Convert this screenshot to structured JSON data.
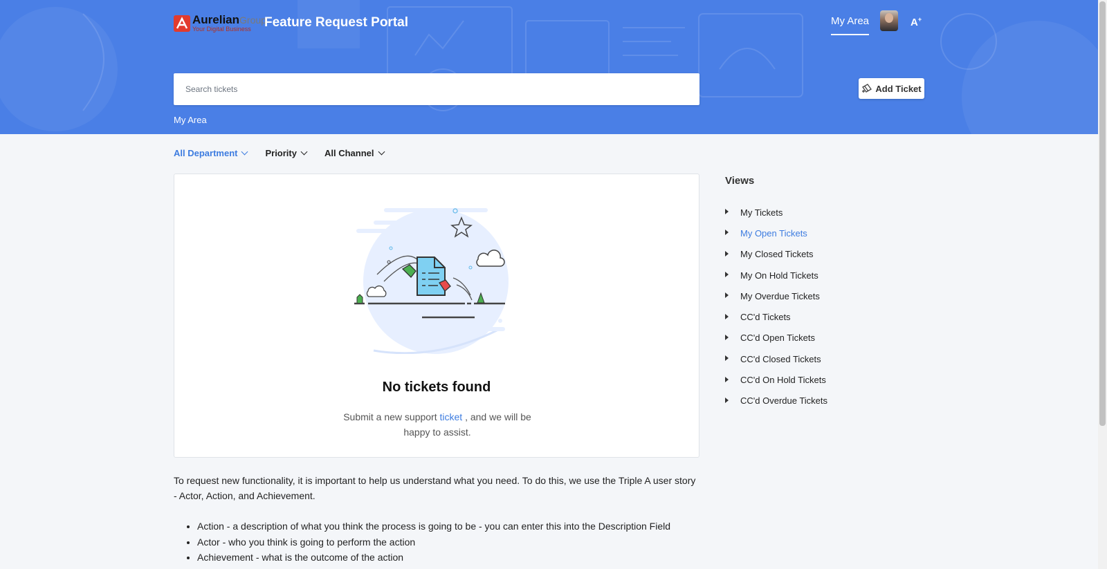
{
  "header": {
    "logo_name": "Aurelian",
    "logo_group": "Group",
    "logo_tagline": "Your Digital Business",
    "portal_title": "Feature Request Portal",
    "nav_my_area": "My Area",
    "font_size_label": "A",
    "font_size_sup": "+"
  },
  "search": {
    "placeholder": "Search tickets"
  },
  "add_ticket_label": "Add Ticket",
  "breadcrumb": "My Area",
  "filters": [
    {
      "label": "All Department",
      "active": true
    },
    {
      "label": "Priority",
      "active": false
    },
    {
      "label": "All Channel",
      "active": false
    }
  ],
  "empty_state": {
    "title": "No tickets found",
    "msg_before": "Submit a new support",
    "msg_link": "ticket",
    "msg_after": ", and we will be happy to assist."
  },
  "views": {
    "title": "Views",
    "items": [
      {
        "label": "My Tickets",
        "active": false
      },
      {
        "label": "My Open Tickets",
        "active": true
      },
      {
        "label": "My Closed Tickets",
        "active": false
      },
      {
        "label": "My On Hold Tickets",
        "active": false
      },
      {
        "label": "My Overdue Tickets",
        "active": false
      },
      {
        "label": "CC'd Tickets",
        "active": false
      },
      {
        "label": "CC'd Open Tickets",
        "active": false
      },
      {
        "label": "CC'd Closed Tickets",
        "active": false
      },
      {
        "label": "CC'd On Hold Tickets",
        "active": false
      },
      {
        "label": "CC'd Overdue Tickets",
        "active": false
      }
    ]
  },
  "description": "To request new functionality, it is important to help us understand what you need. To do this, we use the Triple A user story - Actor, Action, and Achievement.",
  "bullets": [
    "Action - a description of what you think the process is going to be - you can enter this into the Description Field",
    "Actor - who you think is going to perform the action",
    "Achievement - what is the outcome of the action"
  ],
  "colors": {
    "header_blue": "#4a7fe6",
    "accent": "#3d7ce0",
    "page_bg": "#f4f6f9"
  }
}
